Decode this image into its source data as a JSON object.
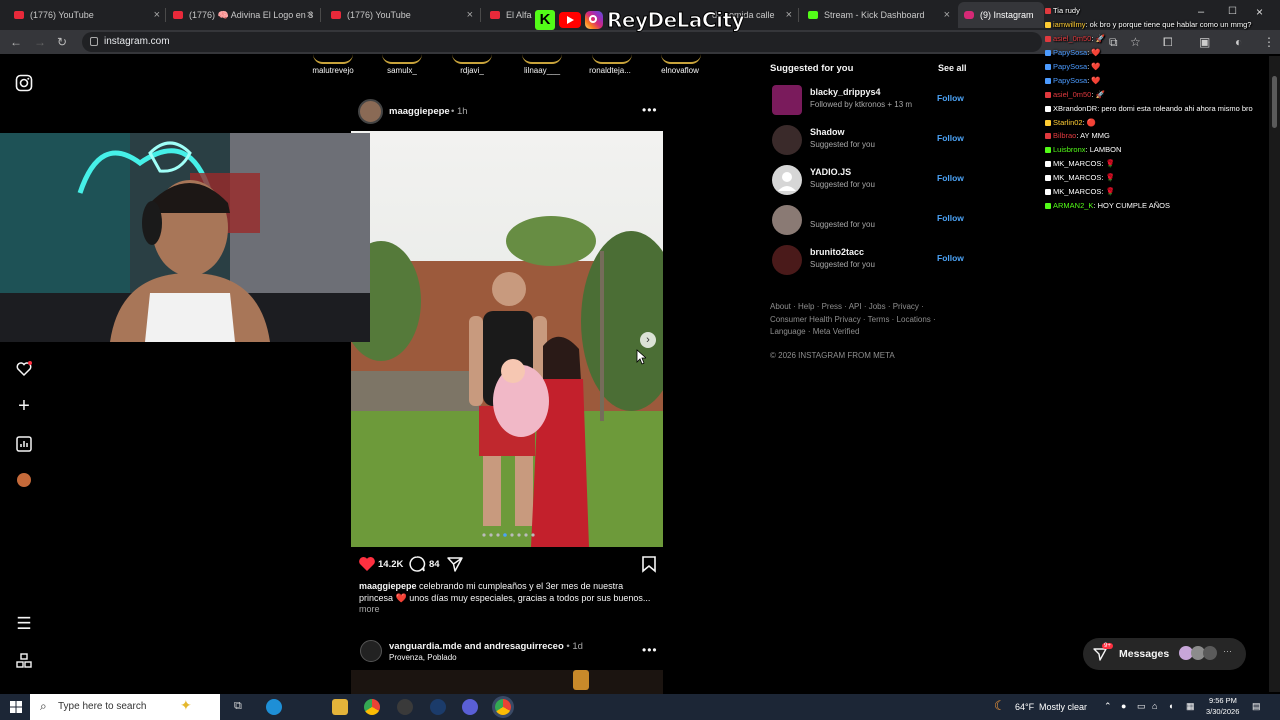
{
  "browser": {
    "tabs": [
      {
        "label": "(1776) YouTube"
      },
      {
        "label": "(1776) 🧠 Adivina El Logo en 3"
      },
      {
        "label": "(1776) YouTube"
      },
      {
        "label": "El Alfa"
      },
      {
        "label": "do comida calle"
      },
      {
        "label": "Stream - Kick Dashboard"
      },
      {
        "label": "(9) Instagram"
      }
    ],
    "url": "instagram.com"
  },
  "overlay": {
    "brand_name": "ReyDeLaCity"
  },
  "stories": [
    {
      "name": "malutrevejo"
    },
    {
      "name": "samulx_"
    },
    {
      "name": "rdjavi_"
    },
    {
      "name": "lilnaay___"
    },
    {
      "name": "ronaldteja..."
    },
    {
      "name": "elnovaflow"
    }
  ],
  "post": {
    "username": "maaggiepepe",
    "time": "• 1h",
    "likes": "14.2K",
    "comments": "84",
    "caption_user": "maaggiepepe",
    "caption_text": "celebrando mi cumpleaños y el 3er mes de nuestra princesa ❤️ unos días muy especiales, gracias a todos por sus buenos...",
    "caption_more": "more"
  },
  "post2": {
    "users": "vanguardia.mde and andresaguirreceo",
    "time": "• 1d",
    "location": "Provenza, Poblado"
  },
  "suggested": {
    "title": "Suggested for you",
    "see_all": "See all",
    "items": [
      {
        "name": "blacky_drippys4",
        "sub": "Followed by ktkronos + 13 m",
        "follow": "Follow",
        "color": "#7a1b5c"
      },
      {
        "name": "Shadow",
        "sub": "Suggested for you",
        "follow": "Follow",
        "color": "#3a2a2a"
      },
      {
        "name": "YADIO.JS",
        "sub": "Suggested for you",
        "follow": "Follow",
        "color": "#d6d6d6"
      },
      {
        "name": "",
        "sub": "Suggested for you",
        "follow": "Follow",
        "color": "#8a7a74"
      },
      {
        "name": "brunito2tacc",
        "sub": "Suggested for you",
        "follow": "Follow",
        "color": "#4a1a1a"
      }
    ]
  },
  "footer": {
    "links": "About · Help · Press · API · Jobs · Privacy · Consumer Health Privacy · Terms · Locations · Language · Meta Verified",
    "copyright": "© 2026 INSTAGRAM FROM META"
  },
  "chat": [
    {
      "user": "",
      "text": "Tia rudy",
      "color": "#e0393e"
    },
    {
      "user": "iamwillmy",
      "text": ": ok bro y porque tiene que hablar como un mmg?",
      "color": "#ffcc33"
    },
    {
      "user": "asiel_0m50",
      "text": ": 🚀",
      "color": "#e0393e"
    },
    {
      "user": "PapySosa",
      "text": ": ❤️",
      "color": "#4c9bff"
    },
    {
      "user": "PapySosa",
      "text": ": ❤️",
      "color": "#4c9bff"
    },
    {
      "user": "PapySosa",
      "text": ": ❤️",
      "color": "#4c9bff"
    },
    {
      "user": "asiel_0m50",
      "text": ": 🚀",
      "color": "#e0393e"
    },
    {
      "user": "XBrandonDR",
      "text": ": pero domi esta roleando ahi ahora mismo bro",
      "color": "#ffffff"
    },
    {
      "user": "Starlin02",
      "text": ": 🔴",
      "color": "#ffcc33"
    },
    {
      "user": "Bilbrao",
      "text": ": AY MMG",
      "color": "#e0393e"
    },
    {
      "user": "Luisbronx",
      "text": ": LAMBON",
      "color": "#53fc18"
    },
    {
      "user": "MK_MARCOS",
      "text": ": 🌹",
      "color": "#ffffff"
    },
    {
      "user": "MK_MARCOS",
      "text": ": 🌹",
      "color": "#ffffff"
    },
    {
      "user": "MK_MARCOS",
      "text": ": 🌹",
      "color": "#ffffff"
    },
    {
      "user": "ARMAN2_K",
      "text": ": HOY CUMPLE AÑOS",
      "color": "#53fc18"
    }
  ],
  "messages": {
    "label": "Messages",
    "badge": "9+"
  },
  "taskbar": {
    "search_placeholder": "Type here to search",
    "weather_temp": "64°F",
    "weather_text": "Mostly clear",
    "time": "9:56 PM",
    "date": "3/30/2026"
  }
}
